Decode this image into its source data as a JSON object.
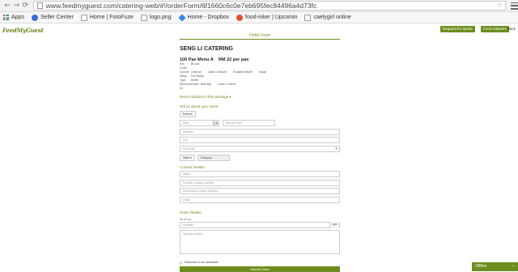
{
  "browser": {
    "url": "www.feedmyguest.com/catering-web/#!/orderForm/6f1660c6c0e7eb695fec84496a4d73fc",
    "bookmarks": [
      "Apps",
      "Seller Center",
      "Home | FotoFuze",
      "logo.png",
      "Home - Dropbox",
      "food-inker | Upcomin",
      "caelygirl online"
    ]
  },
  "header": {
    "logo": "FeedMyGuest",
    "request_quote": "Request for Quote",
    "food_caterers": "Food Caterers",
    "back": "Back"
  },
  "form": {
    "title": "Order Form",
    "caterer": "SENG LI CATERING",
    "menu_name": "100 Pax Menu A",
    "menu_price": "RM 22 per pax",
    "details": [
      {
        "k": "Min Order",
        "v": [
          "80 pax"
        ]
      },
      {
        "k": "Cuisine",
        "v": [
          "Chinese",
          "Cake / Dessert",
          "Roasted Whole",
          "Satay"
        ]
      },
      {
        "k": "Setup",
        "v": [
          "Full Setup"
        ]
      },
      {
        "k": "Type",
        "v": [
          "Buffet"
        ]
      },
      {
        "k": "Recommended for",
        "v": [
          "Birthday",
          "Lunch / Dinner"
        ]
      }
    ],
    "items_link": "Items included in this package ▸",
    "section_event": "Tell us about your event",
    "event_type": "Event ▾",
    "date_placeholder": "Date",
    "service_time_placeholder": "Service Time",
    "address_placeholder": "Address",
    "city_placeholder": "City",
    "postcode_placeholder": "Postcode",
    "state_select": "State ▾",
    "country_value": "Malaysia",
    "section_contact": "Contact Details",
    "name_placeholder": "Name",
    "phone_placeholder": "Primary Contact Number",
    "secondary_phone_placeholder": "Secondary Contact Number",
    "email_placeholder": "Email",
    "section_order": "Order Details",
    "min_pax_label": "Min 80 pax",
    "quantity_placeholder": "Quantity",
    "quantity_suffix": "pax",
    "special_request_placeholder": "Special request",
    "subscribe_label": "Subscribe to our newsletter",
    "submit": "Submit Order"
  },
  "chat": {
    "status": "Offline",
    "minimize": "–"
  },
  "colors": {
    "accent": "#6d8e1e"
  }
}
